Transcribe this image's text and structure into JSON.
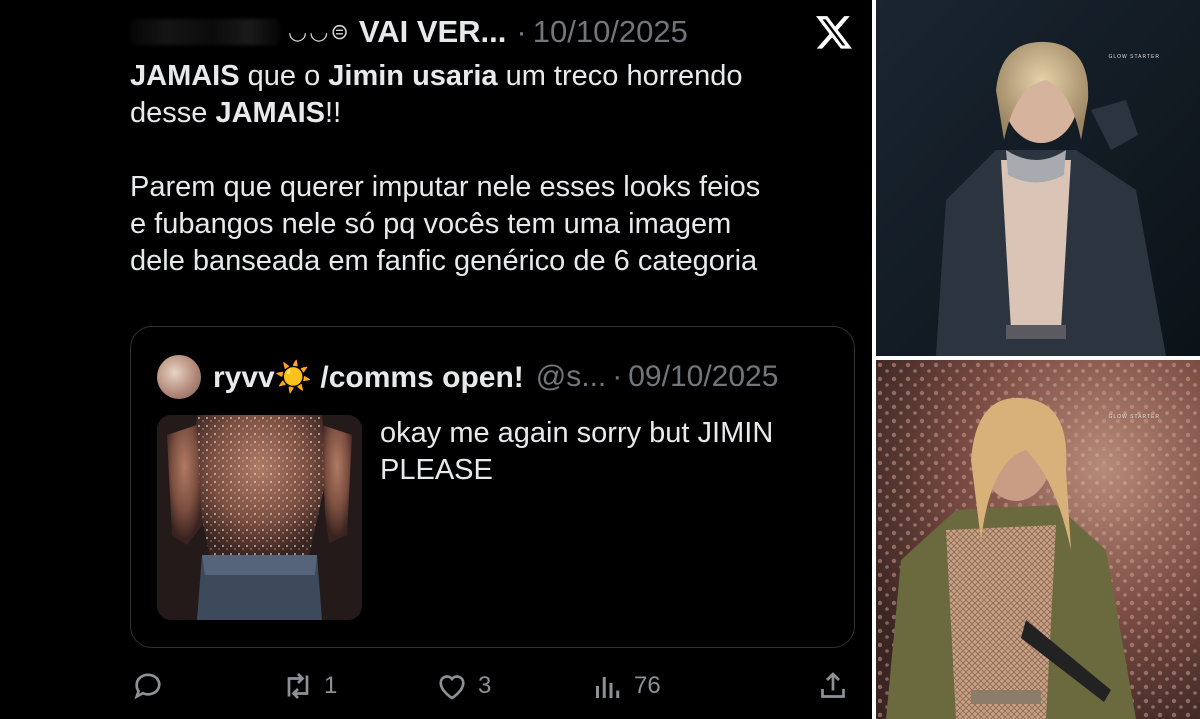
{
  "tweet": {
    "display_name": "VAI VER...",
    "emoji_row": "◡◡⊜",
    "date": "10/10/2025",
    "dot": "·",
    "text": {
      "line1_part1": "JAMAIS",
      "line1_part2": " que o ",
      "line1_part3": "Jimin usaria",
      "line1_part4": " um treco horrendo",
      "line2_part1": "desse ",
      "line2_part2": "JAMAIS",
      "line2_part3": "!!",
      "line3": "Parem que querer imputar nele esses looks feios",
      "line4": "e fubangos nele só pq vocês tem uma imagem",
      "line5": "dele banseada em fanfic genérico de 6 categoria"
    }
  },
  "quote": {
    "name": "ryvv☀️ /comms open!",
    "handle": "@s...",
    "dot": "·",
    "date": "09/10/2025",
    "text": "okay me again sorry but JIMIN PLEASE"
  },
  "actions": {
    "reply": {
      "icon": "reply-icon"
    },
    "repost": {
      "icon": "repost-icon",
      "count": "1"
    },
    "like": {
      "icon": "heart-icon",
      "count": "3"
    },
    "views": {
      "icon": "views-icon",
      "count": "76"
    },
    "share": {
      "icon": "share-icon"
    }
  },
  "photos": {
    "top_watermark": "GLOW STARTER",
    "bottom_watermark": "GLOW STARTER"
  },
  "colors": {
    "background": "#000000",
    "text": "#e7e9ea",
    "muted": "#71767b",
    "border": "#2f3336"
  }
}
